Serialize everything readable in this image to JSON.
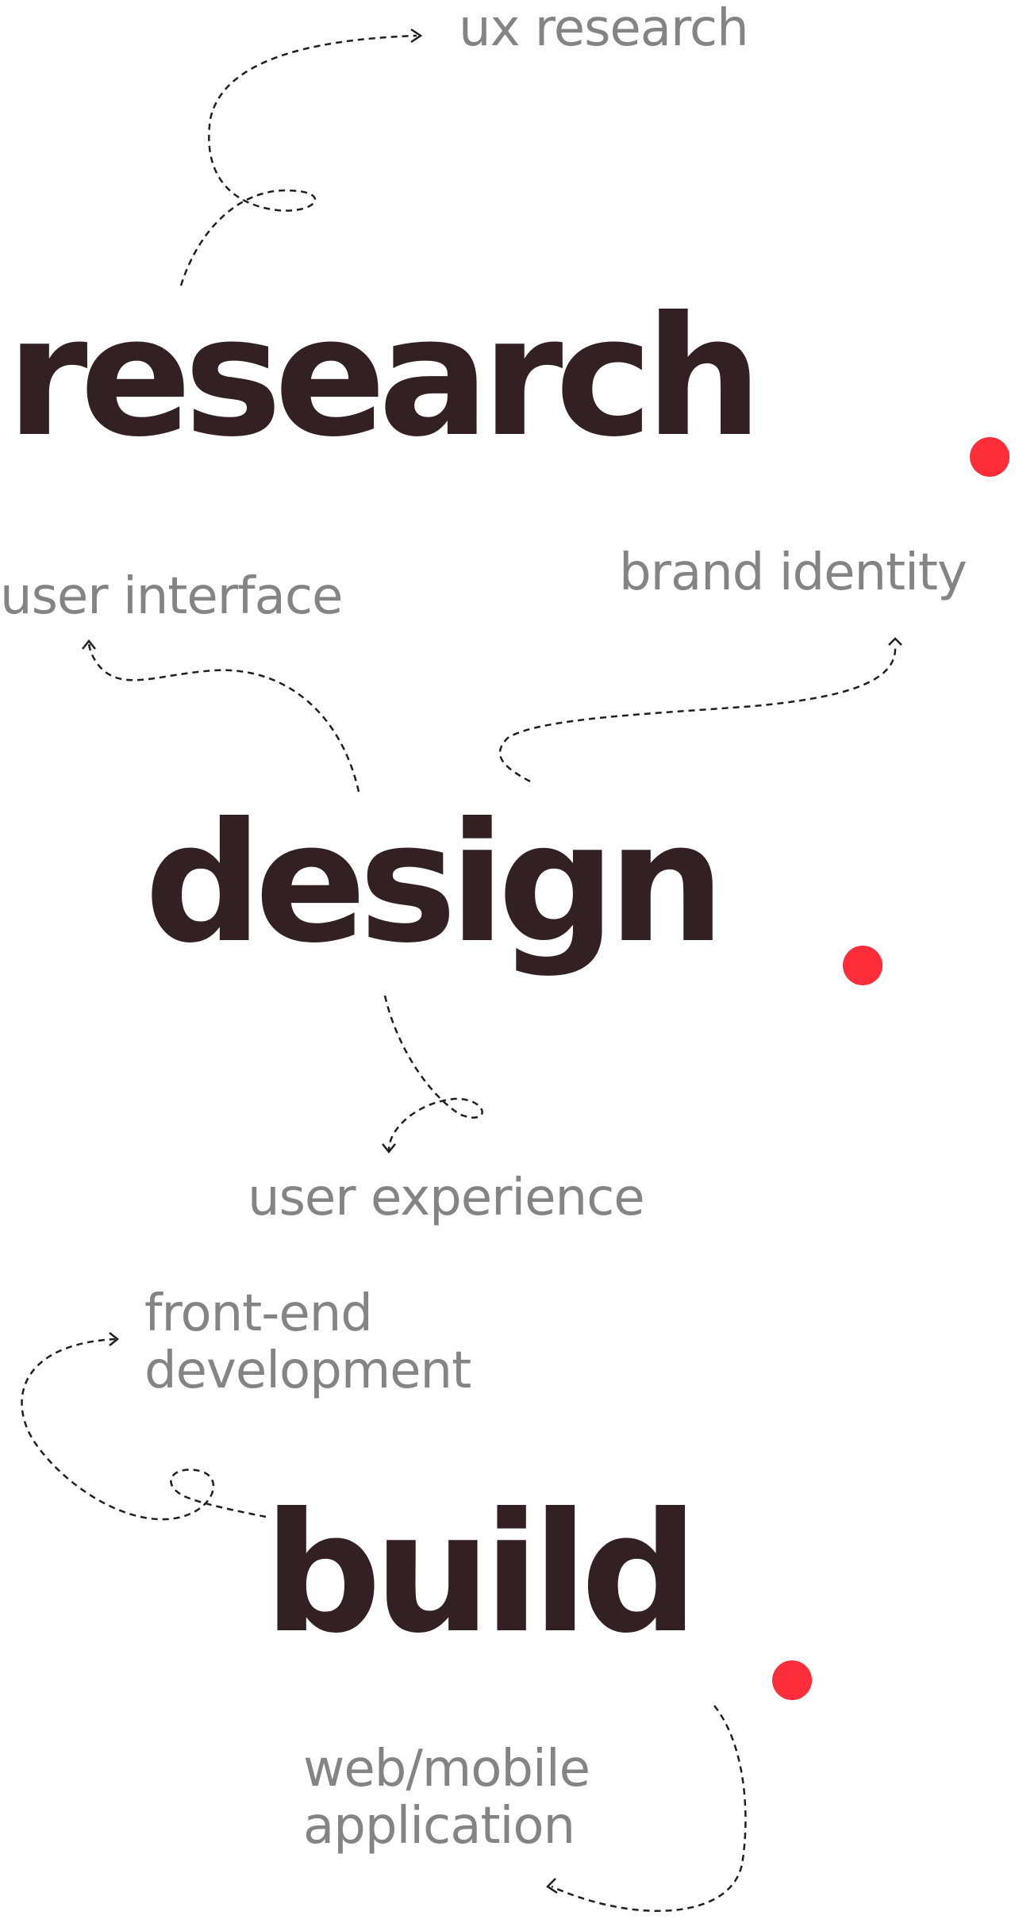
{
  "stages": [
    {
      "word": "research",
      "subtopics": [
        {
          "lines": [
            "ux research"
          ]
        }
      ]
    },
    {
      "word": "design",
      "subtopics": [
        {
          "lines": [
            "user interface"
          ]
        },
        {
          "lines": [
            "brand identity"
          ]
        },
        {
          "lines": [
            "user experience"
          ]
        }
      ]
    },
    {
      "word": "build",
      "subtopics": [
        {
          "lines": [
            "front-end",
            "development"
          ]
        },
        {
          "lines": [
            "web/mobile",
            "application"
          ]
        }
      ]
    }
  ],
  "colors": {
    "heading": "#332022",
    "subtopic": "#848484",
    "accent_dot": "#fe2d3a",
    "connector": "#1f1f1f"
  }
}
